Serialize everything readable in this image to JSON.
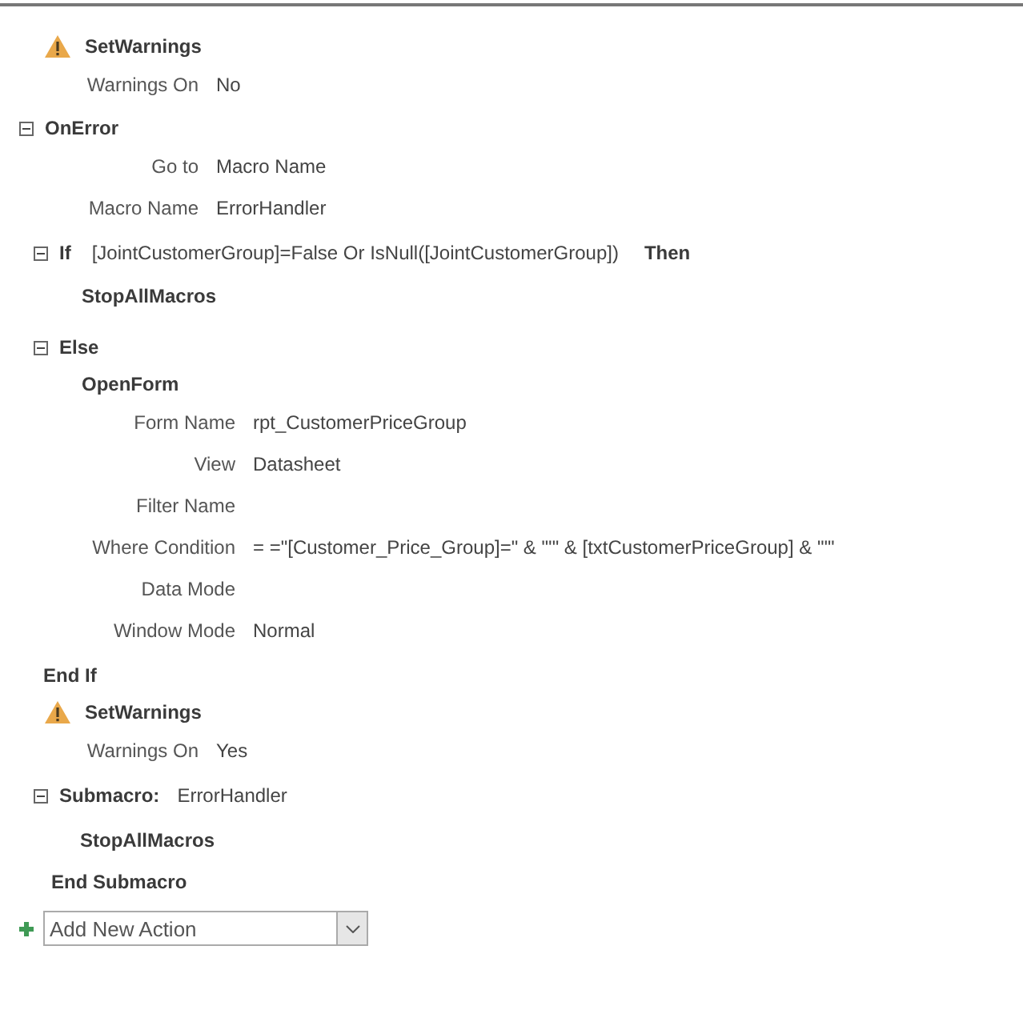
{
  "blocks": [
    {
      "kind": "action",
      "name": "SetWarnings",
      "warning": true,
      "args": [
        {
          "label": "Warnings On",
          "value": "No"
        }
      ]
    },
    {
      "kind": "action",
      "name": "OnError",
      "expanded": true,
      "args": [
        {
          "label": "Go to",
          "value": "Macro Name"
        },
        {
          "label": "Macro Name",
          "value": "ErrorHandler"
        }
      ]
    },
    {
      "kind": "if",
      "keyword": "If",
      "condition": "[JointCustomerGroup]=False Or IsNull([JointCustomerGroup])",
      "then": "Then",
      "expanded": true,
      "children": [
        {
          "kind": "action",
          "name": "StopAllMacros"
        }
      ]
    },
    {
      "kind": "else",
      "keyword": "Else",
      "expanded": true,
      "children": [
        {
          "kind": "action",
          "name": "OpenForm",
          "args": [
            {
              "label": "Form Name",
              "value": "rpt_CustomerPriceGroup"
            },
            {
              "label": "View",
              "value": "Datasheet"
            },
            {
              "label": "Filter Name"
            },
            {
              "label": "Where Condition",
              "value": "= =\"[Customer_Price_Group]=\" & \"'\" & [txtCustomerPriceGroup] & \"'\""
            },
            {
              "label": "Data Mode"
            },
            {
              "label": "Window Mode",
              "value": "Normal"
            }
          ]
        }
      ]
    },
    {
      "kind": "end",
      "label": "End If"
    },
    {
      "kind": "action",
      "name": "SetWarnings",
      "warning": true,
      "args": [
        {
          "label": "Warnings On",
          "value": "Yes"
        }
      ]
    },
    {
      "kind": "submacro",
      "keyword": "Submacro:",
      "name": "ErrorHandler",
      "expanded": true,
      "end": "End Submacro",
      "children": [
        {
          "kind": "action",
          "name": "StopAllMacros"
        }
      ]
    }
  ],
  "add_action": {
    "placeholder": "Add New Action"
  }
}
